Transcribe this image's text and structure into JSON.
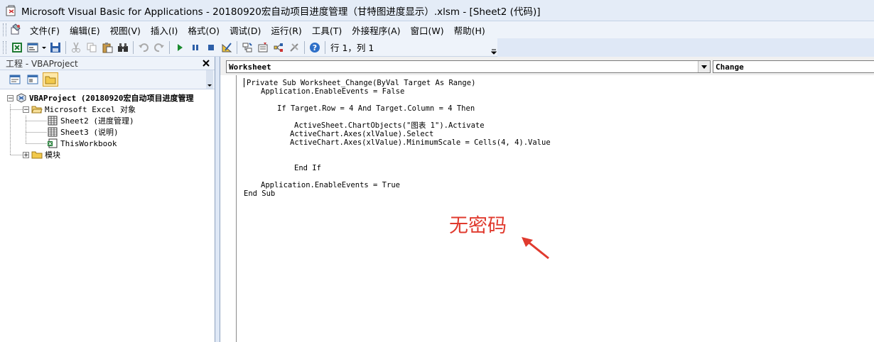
{
  "window": {
    "title": "Microsoft Visual Basic for Applications - 20180920宏自动项目进度管理（甘特图进度显示）.xlsm - [Sheet2 (代码)]"
  },
  "menu": {
    "items": [
      "文件(F)",
      "编辑(E)",
      "视图(V)",
      "插入(I)",
      "格式(O)",
      "调试(D)",
      "运行(R)",
      "工具(T)",
      "外接程序(A)",
      "窗口(W)",
      "帮助(H)"
    ]
  },
  "toolbar": {
    "status": "行 1，列 1"
  },
  "project_pane": {
    "title": "工程 - VBAProject",
    "tree": {
      "root": "VBAProject (20180920宏自动项目进度管理",
      "excel_objects": "Microsoft Excel 对象",
      "sheet2": "Sheet2 (进度管理)",
      "sheet3": "Sheet3 (说明)",
      "workbook": "ThisWorkbook",
      "modules": "模块"
    }
  },
  "code_window": {
    "object_combo": "Worksheet",
    "procedure_combo": "Change",
    "lines": [
      "Private Sub Worksheet_Change(ByVal Target As Range)",
      "Application.EnableEvents = False",
      "If Target.Row = 4 And Target.Column = 4 Then",
      "ActiveSheet.ChartObjects(\"图表 1\").Activate",
      "ActiveChart.Axes(xlValue).Select",
      "ActiveChart.Axes(xlValue).MinimumScale = Cells(4, 4).Value",
      "End If",
      "Application.EnableEvents = True",
      "End Sub"
    ]
  },
  "annotation": {
    "text": "无密码",
    "color": "#e03a2e"
  }
}
